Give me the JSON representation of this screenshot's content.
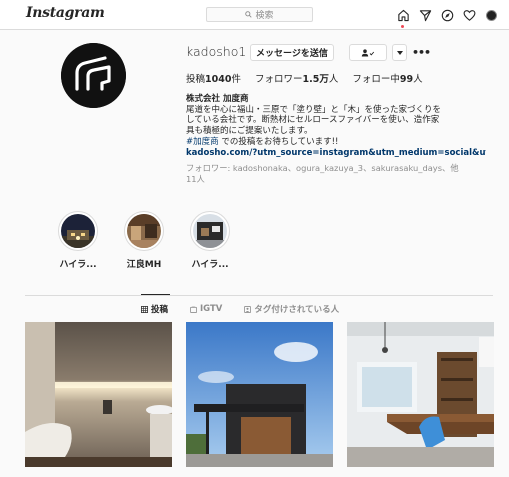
{
  "topbar": {
    "logo": "Instagram",
    "search_placeholder": "検索",
    "icons": [
      "home-icon",
      "direct-icon",
      "explore-icon",
      "heart-icon",
      "profile-avatar"
    ]
  },
  "profile": {
    "username": "kadosho1",
    "message_button": "メッセージを送信",
    "stats": {
      "posts_label": "投稿",
      "posts_value": "1040",
      "posts_unit": "件",
      "followers_label": "フォロワー",
      "followers_value": "1.5万",
      "followers_unit": "人",
      "following_label": "フォロー中",
      "following_value": "99",
      "following_unit": "人"
    },
    "bio": {
      "name": "株式会社 加度商",
      "line1": "尾道を中心に福山・三原で「塗り壁」と「木」を使った家づくりを",
      "line2": "している会社です。断熱材にセルロースファイバーを使い、造作家",
      "line3": "具も積極的にご提案いたします。",
      "hashtag": "#加度商",
      "line4_rest": " での投稿をお待ちしています!!",
      "link": "kadosho.com/?utm_source=instagram&utm_medium=social&ut...",
      "followed_prefix": "フォロワー: ",
      "followed_names": "kadoshonaka、ogura_kazuya_3、sakurasaku_days、他",
      "followed_suffix": "11人"
    }
  },
  "highlights": [
    {
      "label": "ハイラ..."
    },
    {
      "label": "江良MH"
    },
    {
      "label": "ハイラ..."
    }
  ],
  "tabs": [
    {
      "label": "投稿",
      "active": true
    },
    {
      "label": "IGTV",
      "active": false
    },
    {
      "label": "タグ付けされている人",
      "active": false
    }
  ],
  "colors": {
    "link": "#00376b",
    "secondary_text": "#8e8e8e",
    "border": "#dbdbdb",
    "notification": "#ed4956"
  }
}
